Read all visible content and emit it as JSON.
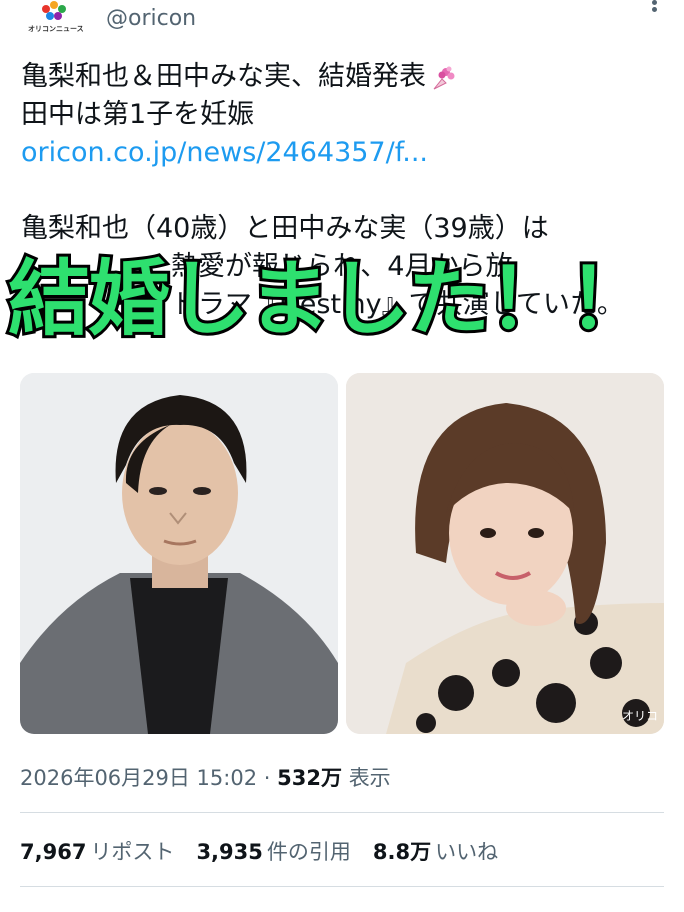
{
  "account": {
    "handle": "@oricon",
    "logo_text": "オリコンニュース"
  },
  "tweet": {
    "line1": "亀梨和也＆田中みな実、結婚発表",
    "line2": "田中は第1子を妊娠",
    "link": "oricon.co.jp/news/2464357/f...",
    "body_line1": "亀梨和也（40歳）と田中みな実（39歳）は",
    "body_line2": "熱愛が報じられ、4月から放",
    "body_line3": "ドラマ『Destiny』で共演していた。"
  },
  "overlay": {
    "caption": "結婚しました！！"
  },
  "images": {
    "watermark": "オリコ"
  },
  "meta": {
    "datetime": "2026年06月29日 15:02",
    "separator": "·",
    "views_count": "532万",
    "views_label": "表示"
  },
  "stats": {
    "reposts_count": "7,967",
    "reposts_label": "リポスト",
    "quotes_count": "3,935",
    "quotes_label": "件の引用",
    "likes_count": "8.8万",
    "likes_label": "いいね"
  },
  "colors": {
    "link": "#1d9bf0",
    "overlay_fill": "#2ee06f",
    "overlay_stroke": "#000000",
    "muted_text": "#536471"
  }
}
